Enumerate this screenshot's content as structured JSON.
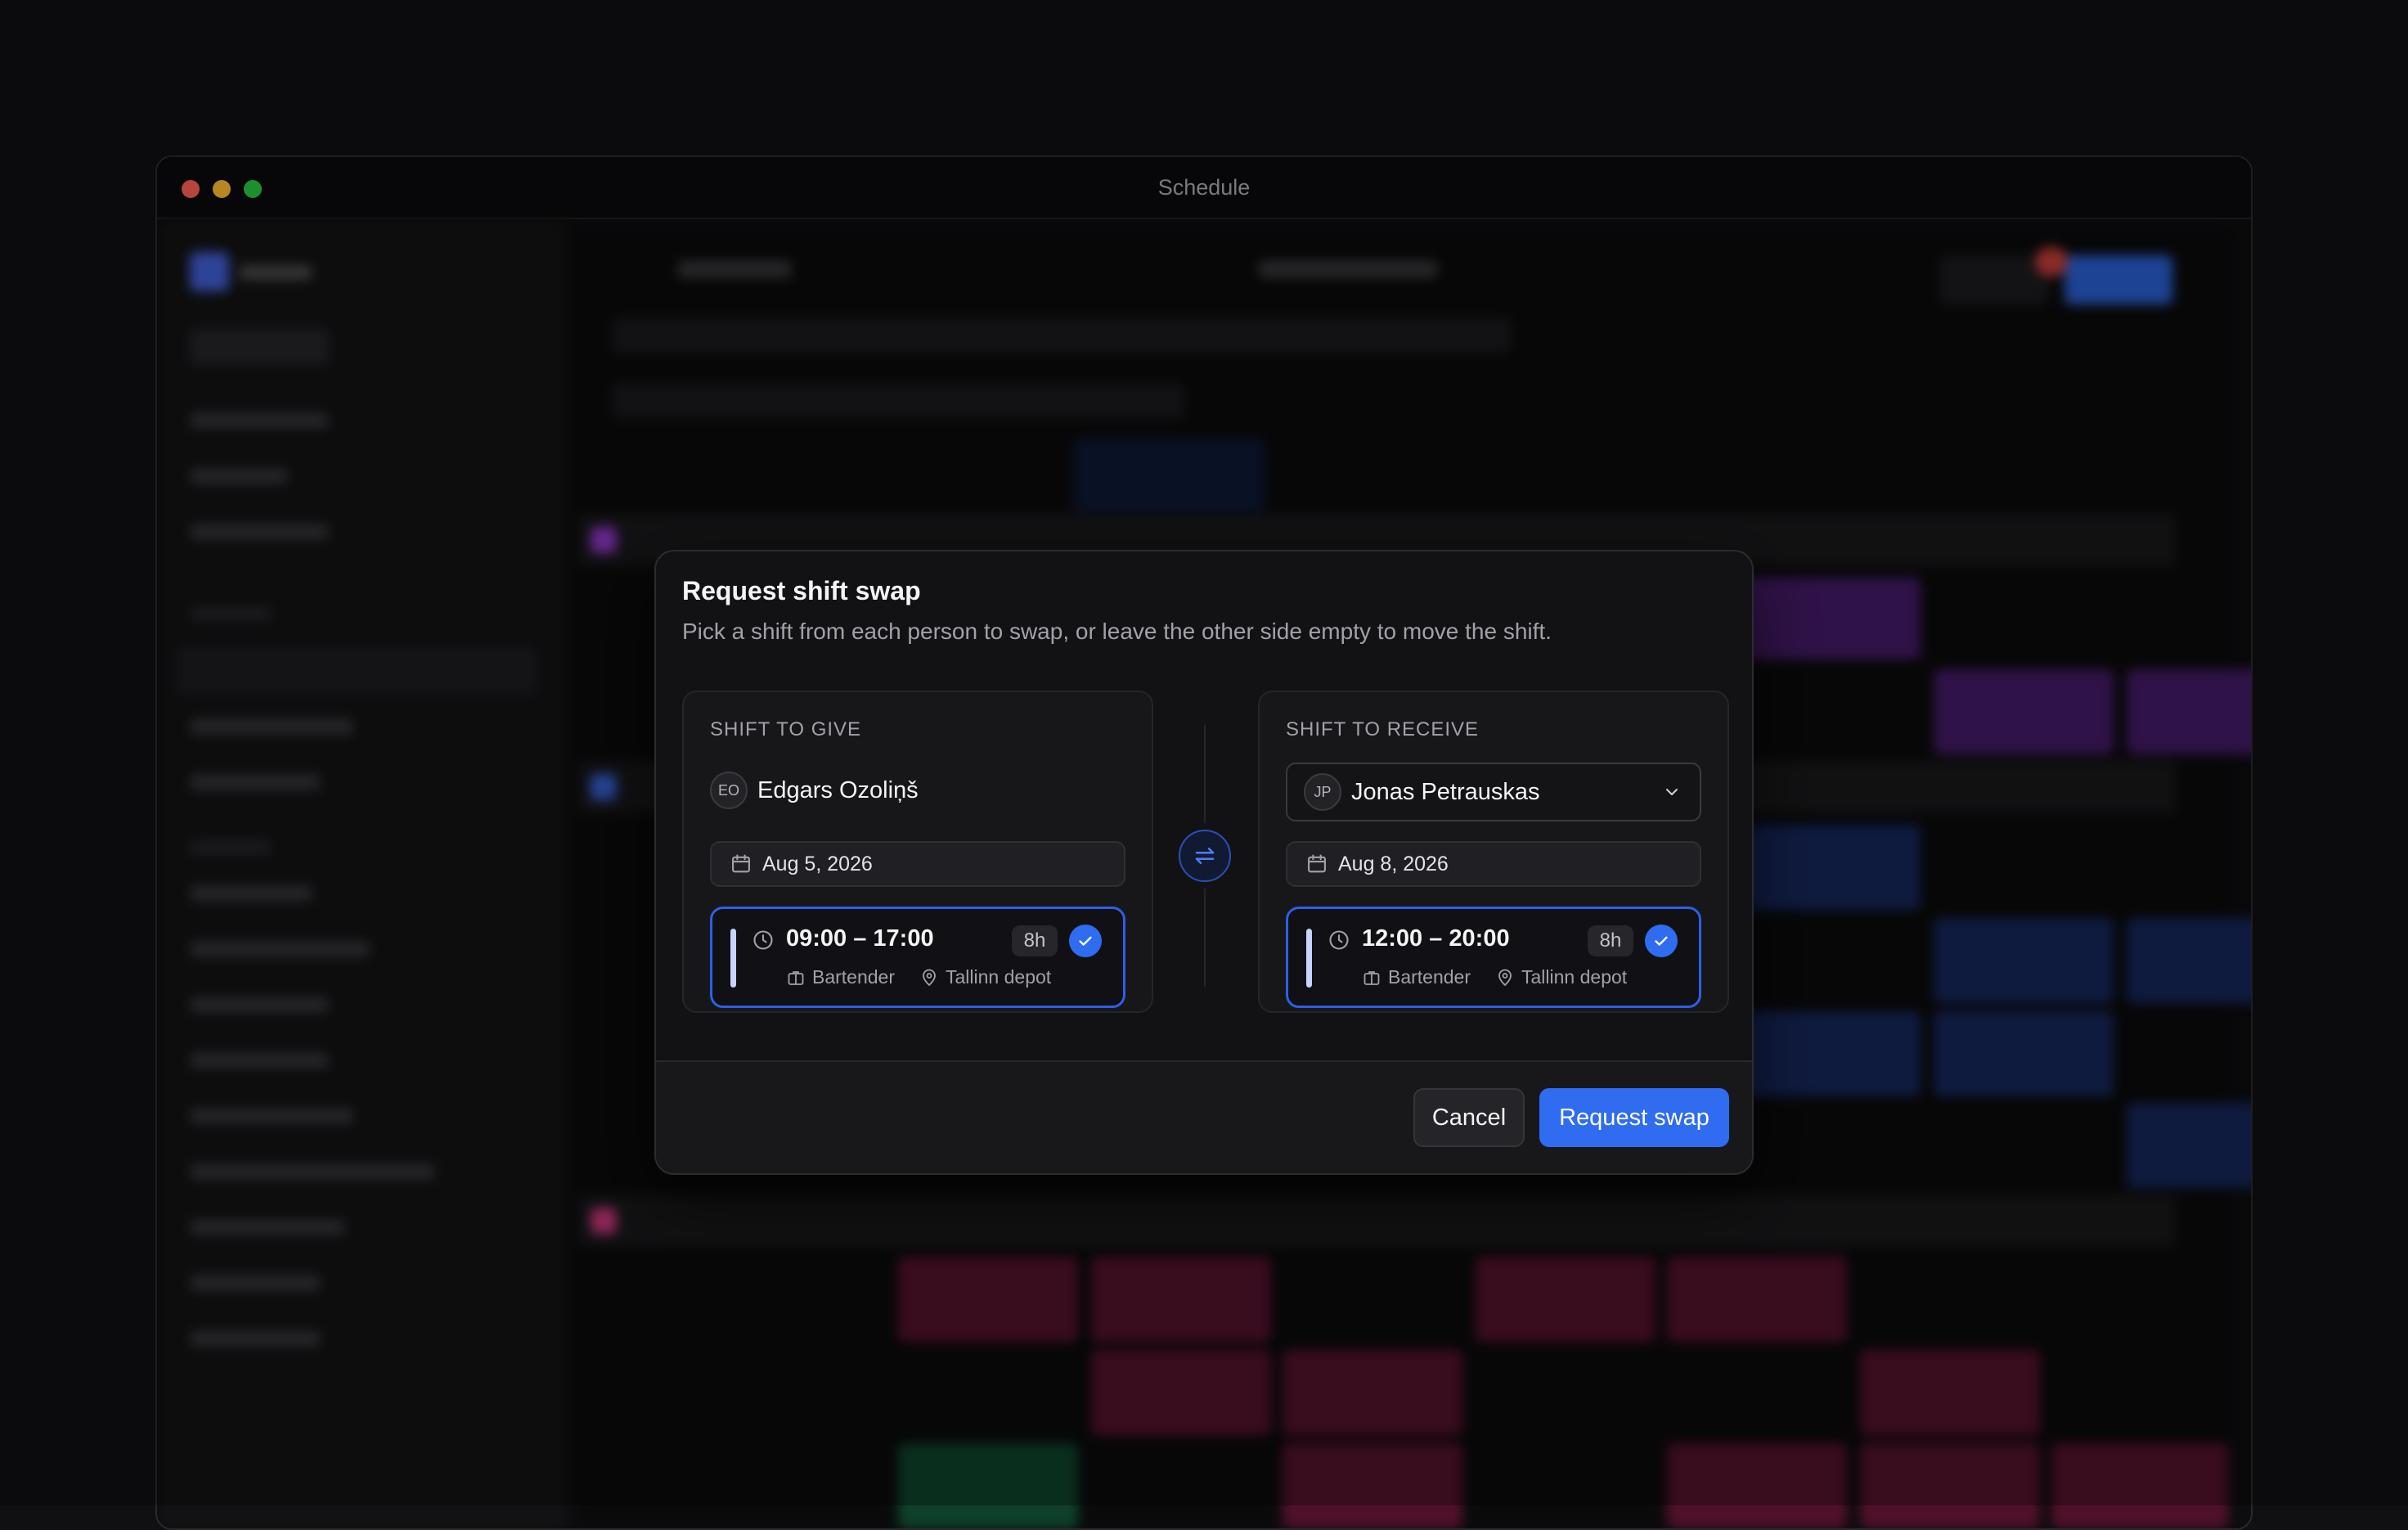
{
  "window": {
    "title": "Schedule"
  },
  "colors": {
    "accent": "#2f6cf0",
    "surface": "#121214",
    "text_muted": "#a1a1aa"
  },
  "modal": {
    "title": "Request shift swap",
    "description": "Pick a shift from each person to swap, or leave the other side empty to move the shift.",
    "give": {
      "label": "SHIFT TO GIVE",
      "person": {
        "initials": "EO",
        "name": "Edgars Ozoliņš"
      },
      "date": "Aug 5, 2026",
      "shift": {
        "time": "09:00 – 17:00",
        "hours": "8h",
        "position": "Bartender",
        "location": "Tallinn depot",
        "selected": true
      }
    },
    "receive": {
      "label": "SHIFT TO RECEIVE",
      "person": {
        "initials": "JP",
        "name": "Jonas Petrauskas"
      },
      "date": "Aug 8, 2026",
      "shift": {
        "time": "12:00 – 20:00",
        "hours": "8h",
        "position": "Bartender",
        "location": "Tallinn depot",
        "selected": true
      }
    },
    "icons": {
      "swap": "swap-arrows-icon",
      "calendar": "calendar-icon",
      "clock": "clock-icon",
      "position": "briefcase-icon",
      "location": "map-pin-icon",
      "check": "check-icon",
      "dropdown": "chevron-down-icon"
    },
    "footer": {
      "cancel_label": "Cancel",
      "submit_label": "Request swap"
    }
  }
}
